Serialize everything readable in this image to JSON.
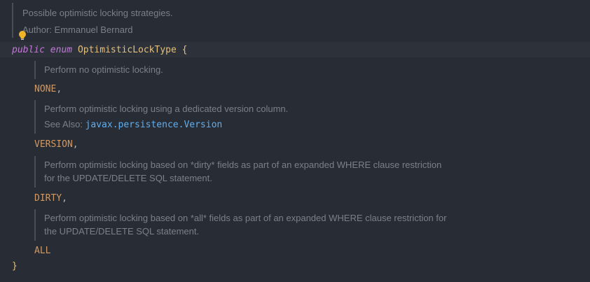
{
  "header_doc": {
    "line1": "Possible optimistic locking strategies.",
    "line2": "Author: Emmanuel Bernard"
  },
  "declaration": {
    "kw_public": "public",
    "kw_enum": "enum",
    "class_name": "OptimisticLockType",
    "open_brace": "{"
  },
  "constants": [
    {
      "doc": [
        "Perform no optimistic locking."
      ],
      "name": "NONE",
      "sep": ","
    },
    {
      "doc": [
        "Perform optimistic locking using a dedicated version column."
      ],
      "see_also_label": "See Also:",
      "see_also_link": "javax.persistence.Version",
      "name": "VERSION",
      "sep": ","
    },
    {
      "doc": [
        "Perform optimistic locking based on *dirty* fields as part of an expanded WHERE clause restriction",
        "for the UPDATE/DELETE SQL statement."
      ],
      "name": "DIRTY",
      "sep": ","
    },
    {
      "doc": [
        "Perform optimistic locking based on *all* fields as part of an expanded WHERE clause restriction for",
        "the UPDATE/DELETE SQL statement."
      ],
      "name": "ALL",
      "sep": ""
    }
  ],
  "close_brace": "}",
  "icons": {
    "intention_bulb": "lightbulb-icon"
  },
  "colors": {
    "background": "#282c34",
    "keyword": "#c678dd",
    "class_name": "#e5c07b",
    "constant": "#d19a66",
    "doc_text": "#7b8089",
    "link": "#61afef"
  }
}
